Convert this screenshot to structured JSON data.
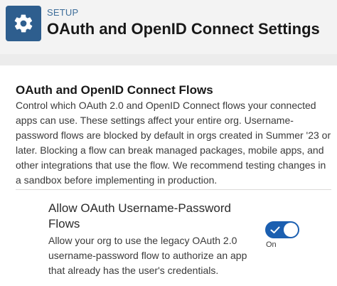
{
  "header": {
    "setup_label": "SETUP",
    "title": "OAuth and OpenID Connect Settings",
    "icon": "gear-icon",
    "icon_color": "#2e5e8e"
  },
  "section": {
    "heading": "OAuth and OpenID Connect Flows",
    "description": "Control which OAuth 2.0 and OpenID Connect flows your connected apps can use. These settings affect your entire org. Username-password flows are blocked by default in orgs created in Summer '23 or later. Blocking a flow can break managed packages, mobile apps, and other integrations that use the flow. We recommend testing changes in a sandbox before implementing in production."
  },
  "setting": {
    "label": "Allow OAuth Username-Password Flows",
    "description": "Allow your org to use the legacy OAuth 2.0 username-password flow to authorize an app that already has the user's credentials.",
    "toggle_state": "On",
    "toggle_on": true,
    "toggle_color": "#1b5fb0",
    "toggle_icon": "checkmark-icon"
  }
}
